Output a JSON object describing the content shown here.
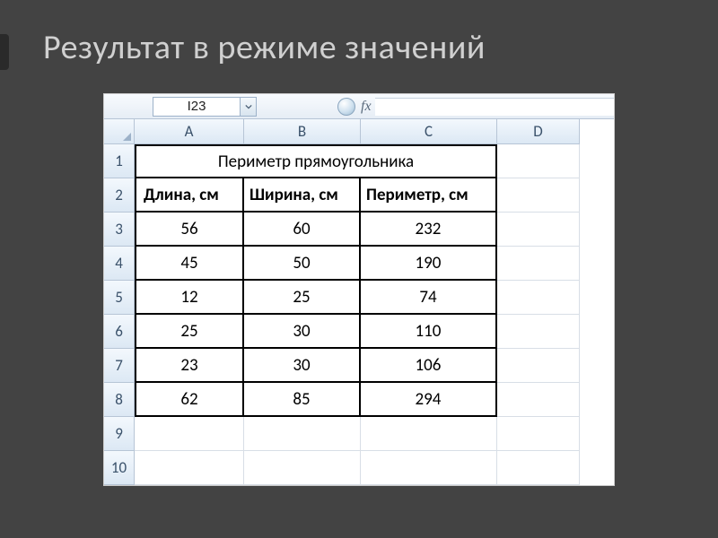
{
  "slide": {
    "title": "Результат в режиме значений"
  },
  "excel": {
    "namebox": "I23",
    "fx": "fx",
    "columns": [
      "A",
      "B",
      "C",
      "D"
    ],
    "row_numbers": [
      "1",
      "2",
      "3",
      "4",
      "5",
      "6",
      "7",
      "8",
      "9",
      "10"
    ],
    "merged_title": "Периметр прямоугольника",
    "headers": {
      "a": "Длина, см",
      "b": "Ширина, см",
      "c": "Периметр, см"
    },
    "rows": [
      {
        "a": "56",
        "b": "60",
        "c": "232"
      },
      {
        "a": "45",
        "b": "50",
        "c": "190"
      },
      {
        "a": "12",
        "b": "25",
        "c": "74"
      },
      {
        "a": "25",
        "b": "30",
        "c": "110"
      },
      {
        "a": "23",
        "b": "30",
        "c": "106"
      },
      {
        "a": "62",
        "b": "85",
        "c": "294"
      }
    ]
  }
}
